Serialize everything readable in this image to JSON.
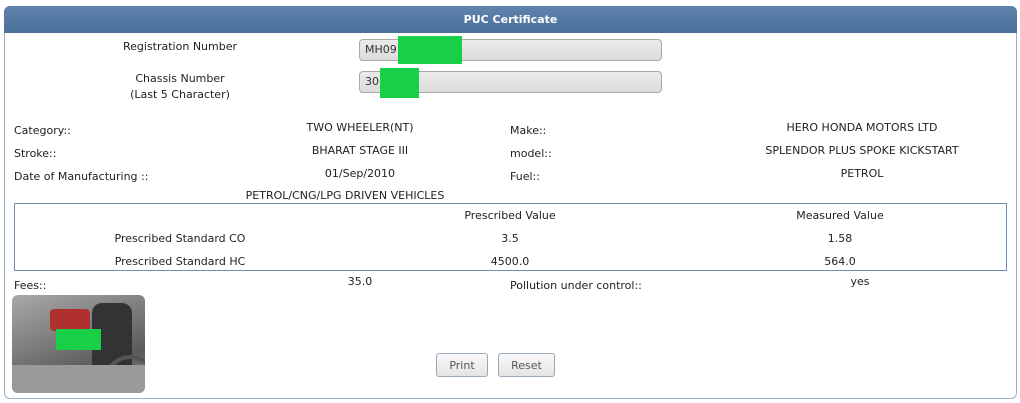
{
  "title": "PUC Certificate",
  "registration": {
    "label": "Registration Number",
    "value": "MH09"
  },
  "chassis": {
    "label_line1": "Chassis Number",
    "label_line2": "(Last 5 Character)",
    "value": "30"
  },
  "details": {
    "category_label": "Category::",
    "category_value": "TWO WHEELER(NT)",
    "make_label": "Make::",
    "make_value": "HERO HONDA MOTORS LTD",
    "stroke_label": "Stroke::",
    "stroke_value": "BHARAT STAGE III",
    "model_label": "model::",
    "model_value": "SPLENDOR PLUS SPOKE KICKSTART",
    "dom_label": "Date of Manufacturing ::",
    "dom_value": "01/Sep/2010",
    "fuel_label": "Fuel::",
    "fuel_value": "PETROL"
  },
  "vehicle_type": "PETROL/CNG/LPG DRIVEN VEHICLES",
  "emissions": {
    "col_prescribed": "Prescribed Value",
    "col_measured": "Measured Value",
    "rows": [
      {
        "label": "Prescribed Standard CO",
        "prescribed": "3.5",
        "measured": "1.58"
      },
      {
        "label": "Prescribed Standard HC",
        "prescribed": "4500.0",
        "measured": "564.0"
      }
    ]
  },
  "fees": {
    "label": "Fees::",
    "value": "35.0"
  },
  "puc": {
    "label": "Pollution under control::",
    "value": "yes"
  },
  "buttons": {
    "print": "Print",
    "reset": "Reset"
  },
  "colors": {
    "header": "#4a6f9a",
    "mask": "#18d048",
    "border": "#6b8fb3"
  }
}
